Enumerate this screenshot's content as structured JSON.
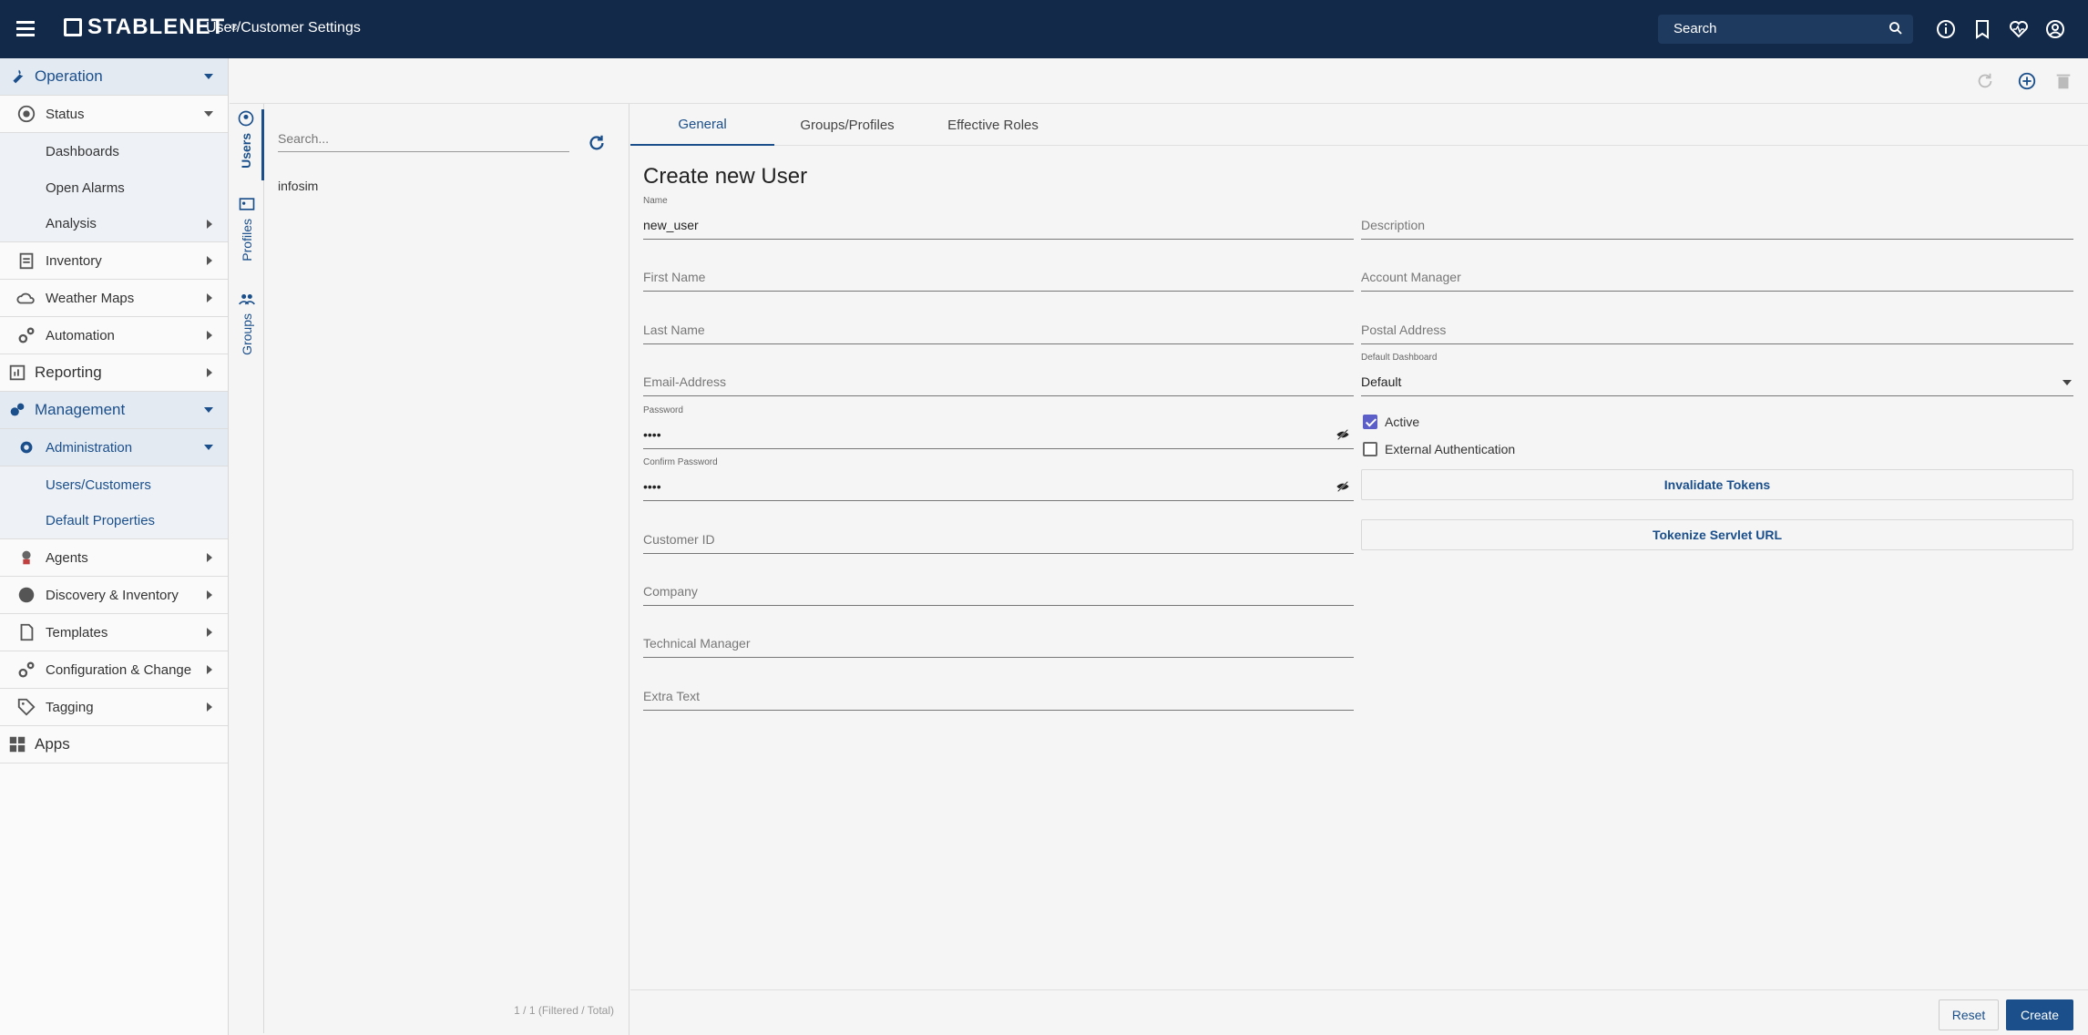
{
  "header": {
    "logo_text": "STABLENET",
    "logo_reg": "®",
    "app_title": "User/Customer Settings",
    "search_placeholder": "Search"
  },
  "sidebar": {
    "operation": "Operation",
    "status": "Status",
    "dashboards": "Dashboards",
    "open_alarms": "Open Alarms",
    "analysis": "Analysis",
    "inventory": "Inventory",
    "weather_maps": "Weather Maps",
    "automation": "Automation",
    "reporting": "Reporting",
    "management": "Management",
    "administration": "Administration",
    "users_customers": "Users/Customers",
    "default_properties": "Default Properties",
    "agents": "Agents",
    "discovery_inventory": "Discovery & Inventory",
    "templates": "Templates",
    "configuration_change": "Configuration & Change",
    "tagging": "Tagging",
    "apps": "Apps"
  },
  "vtabs": {
    "users": "Users",
    "profiles": "Profiles",
    "groups": "Groups"
  },
  "list": {
    "search_placeholder": "Search...",
    "items": [
      "infosim"
    ],
    "footer": "1 / 1 (Filtered / Total)"
  },
  "tabs": {
    "general": "General",
    "groups_profiles": "Groups/Profiles",
    "effective_roles": "Effective Roles"
  },
  "form": {
    "title": "Create new User",
    "name_label": "Name",
    "name_value": "new_user",
    "description": "Description",
    "first_name": "First Name",
    "account_manager": "Account Manager",
    "last_name": "Last Name",
    "postal_address": "Postal Address",
    "email": "Email-Address",
    "default_dashboard_label": "Default Dashboard",
    "default_dashboard_value": "Default",
    "password_label": "Password",
    "password_value": "••••",
    "confirm_password_label": "Confirm Password",
    "confirm_password_value": "••••",
    "active": "Active",
    "active_checked": true,
    "external_auth": "External Authentication",
    "external_auth_checked": false,
    "invalidate_tokens": "Invalidate Tokens",
    "tokenize_url": "Tokenize Servlet URL",
    "customer_id": "Customer ID",
    "company": "Company",
    "technical_manager": "Technical Manager",
    "extra_text": "Extra Text"
  },
  "footer_buttons": {
    "reset": "Reset",
    "create": "Create"
  },
  "colors": {
    "topbar": "#12294a",
    "accent": "#1a4f8b",
    "checkbox": "#5b5fc7"
  }
}
